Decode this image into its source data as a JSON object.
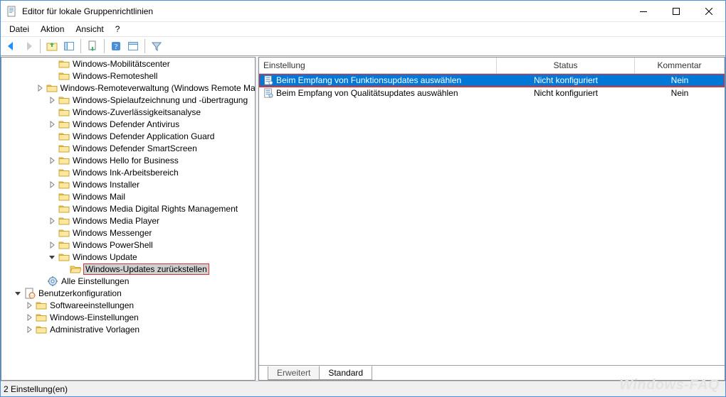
{
  "window": {
    "title": "Editor für lokale Gruppenrichtlinien"
  },
  "menubar": {
    "file": "Datei",
    "action": "Aktion",
    "view": "Ansicht",
    "help": "?"
  },
  "toolbar_icons": {
    "back": "back-arrow",
    "forward": "forward-arrow",
    "up": "up-folder",
    "props": "properties",
    "refresh": "refresh",
    "export": "export-list",
    "help": "help",
    "filter_opts": "filter-options",
    "filter": "filter"
  },
  "tree": {
    "items": [
      {
        "indent": 4,
        "expander": "none",
        "icon": "folder",
        "label": "Windows-Mobilitätscenter"
      },
      {
        "indent": 4,
        "expander": "none",
        "icon": "folder",
        "label": "Windows-Remoteshell"
      },
      {
        "indent": 4,
        "expander": "closed",
        "icon": "folder",
        "label": "Windows-Remoteverwaltung (Windows Remote Management)"
      },
      {
        "indent": 4,
        "expander": "closed",
        "icon": "folder",
        "label": "Windows-Spielaufzeichnung und -übertragung"
      },
      {
        "indent": 4,
        "expander": "none",
        "icon": "folder",
        "label": "Windows-Zuverlässigkeitsanalyse"
      },
      {
        "indent": 4,
        "expander": "closed",
        "icon": "folder",
        "label": "Windows Defender Antivirus"
      },
      {
        "indent": 4,
        "expander": "none",
        "icon": "folder",
        "label": "Windows Defender Application Guard"
      },
      {
        "indent": 4,
        "expander": "none",
        "icon": "folder",
        "label": "Windows Defender SmartScreen"
      },
      {
        "indent": 4,
        "expander": "closed",
        "icon": "folder",
        "label": "Windows Hello for Business"
      },
      {
        "indent": 4,
        "expander": "none",
        "icon": "folder",
        "label": "Windows Ink-Arbeitsbereich"
      },
      {
        "indent": 4,
        "expander": "closed",
        "icon": "folder",
        "label": "Windows Installer"
      },
      {
        "indent": 4,
        "expander": "none",
        "icon": "folder",
        "label": "Windows Mail"
      },
      {
        "indent": 4,
        "expander": "none",
        "icon": "folder",
        "label": "Windows Media Digital Rights Management"
      },
      {
        "indent": 4,
        "expander": "closed",
        "icon": "folder",
        "label": "Windows Media Player"
      },
      {
        "indent": 4,
        "expander": "none",
        "icon": "folder",
        "label": "Windows Messenger"
      },
      {
        "indent": 4,
        "expander": "closed",
        "icon": "folder",
        "label": "Windows PowerShell"
      },
      {
        "indent": 4,
        "expander": "open",
        "icon": "folder",
        "label": "Windows Update"
      },
      {
        "indent": 5,
        "expander": "none",
        "icon": "folder-open",
        "label": "Windows-Updates zurückstellen",
        "selected": true,
        "redbox": true
      },
      {
        "indent": 3,
        "expander": "none",
        "icon": "settings",
        "label": "Alle Einstellungen"
      },
      {
        "indent": 1,
        "expander": "open",
        "icon": "userconfig",
        "label": "Benutzerkonfiguration"
      },
      {
        "indent": 2,
        "expander": "closed",
        "icon": "folder",
        "label": "Softwareeinstellungen"
      },
      {
        "indent": 2,
        "expander": "closed",
        "icon": "folder",
        "label": "Windows-Einstellungen"
      },
      {
        "indent": 2,
        "expander": "closed",
        "icon": "folder",
        "label": "Administrative Vorlagen"
      }
    ]
  },
  "list": {
    "columns": {
      "setting": "Einstellung",
      "state": "Status",
      "comment": "Kommentar"
    },
    "rows": [
      {
        "setting": "Beim Empfang von Funktionsupdates auswählen",
        "state": "Nicht konfiguriert",
        "comment": "Nein",
        "selected": true,
        "redbox": true
      },
      {
        "setting": "Beim Empfang von Qualitätsupdates auswählen",
        "state": "Nicht konfiguriert",
        "comment": "Nein"
      }
    ]
  },
  "tabs": {
    "extended": "Erweitert",
    "standard": "Standard"
  },
  "statusbar": {
    "text": "2 Einstellung(en)"
  },
  "watermark": "Windows-FAQ"
}
